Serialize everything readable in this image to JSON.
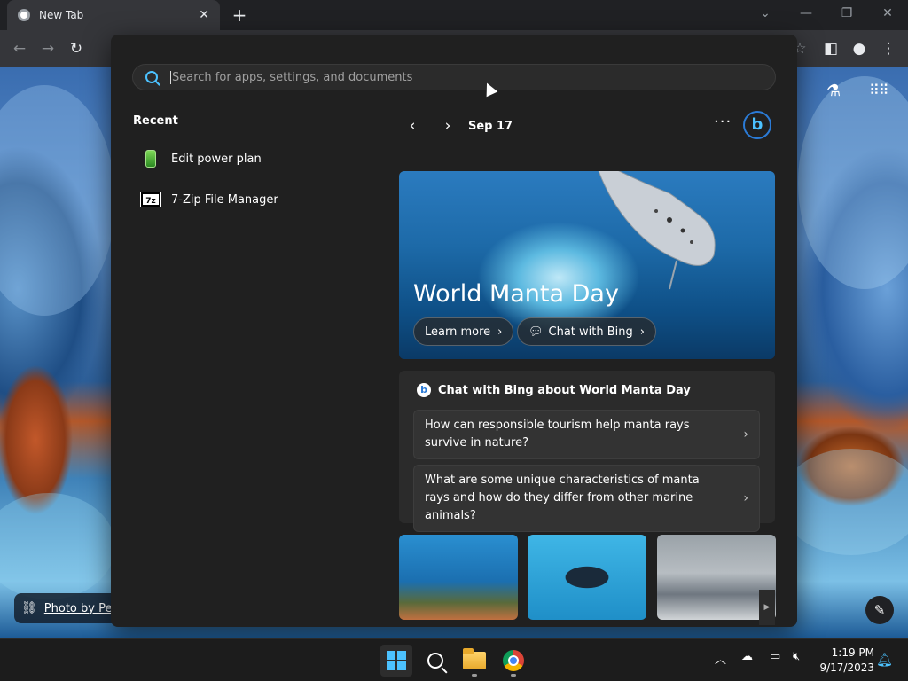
{
  "browser": {
    "tab_title": "New Tab",
    "new_tab": "+",
    "close_tab": "✕"
  },
  "search": {
    "placeholder": "Search for apps, settings, and documents"
  },
  "recent": {
    "heading": "Recent",
    "items": [
      {
        "label": "Edit power plan",
        "icon": "battery-icon"
      },
      {
        "label": "7-Zip File Manager",
        "icon": "7zip-icon",
        "icon_text": "7z"
      }
    ]
  },
  "highlights": {
    "date": "Sep 17",
    "more": "···",
    "hero": {
      "title": "World Manta Day",
      "learn_more": "Learn more",
      "chat_with_bing": "Chat with Bing"
    },
    "chat": {
      "heading": "Chat with Bing about World Manta Day",
      "questions": [
        "How can responsible tourism help manta rays survive in nature?",
        "What are some unique characteristics of manta rays and how do they differ from other marine animals?"
      ]
    }
  },
  "ntp": {
    "photo_credit": "Photo by Pet"
  },
  "taskbar": {
    "time": "1:19 PM",
    "date": "9/17/2023"
  },
  "colors": {
    "accent": "#4cc2ff",
    "panel_bg": "#202020",
    "taskbar_bg": "#1c1c1c"
  }
}
